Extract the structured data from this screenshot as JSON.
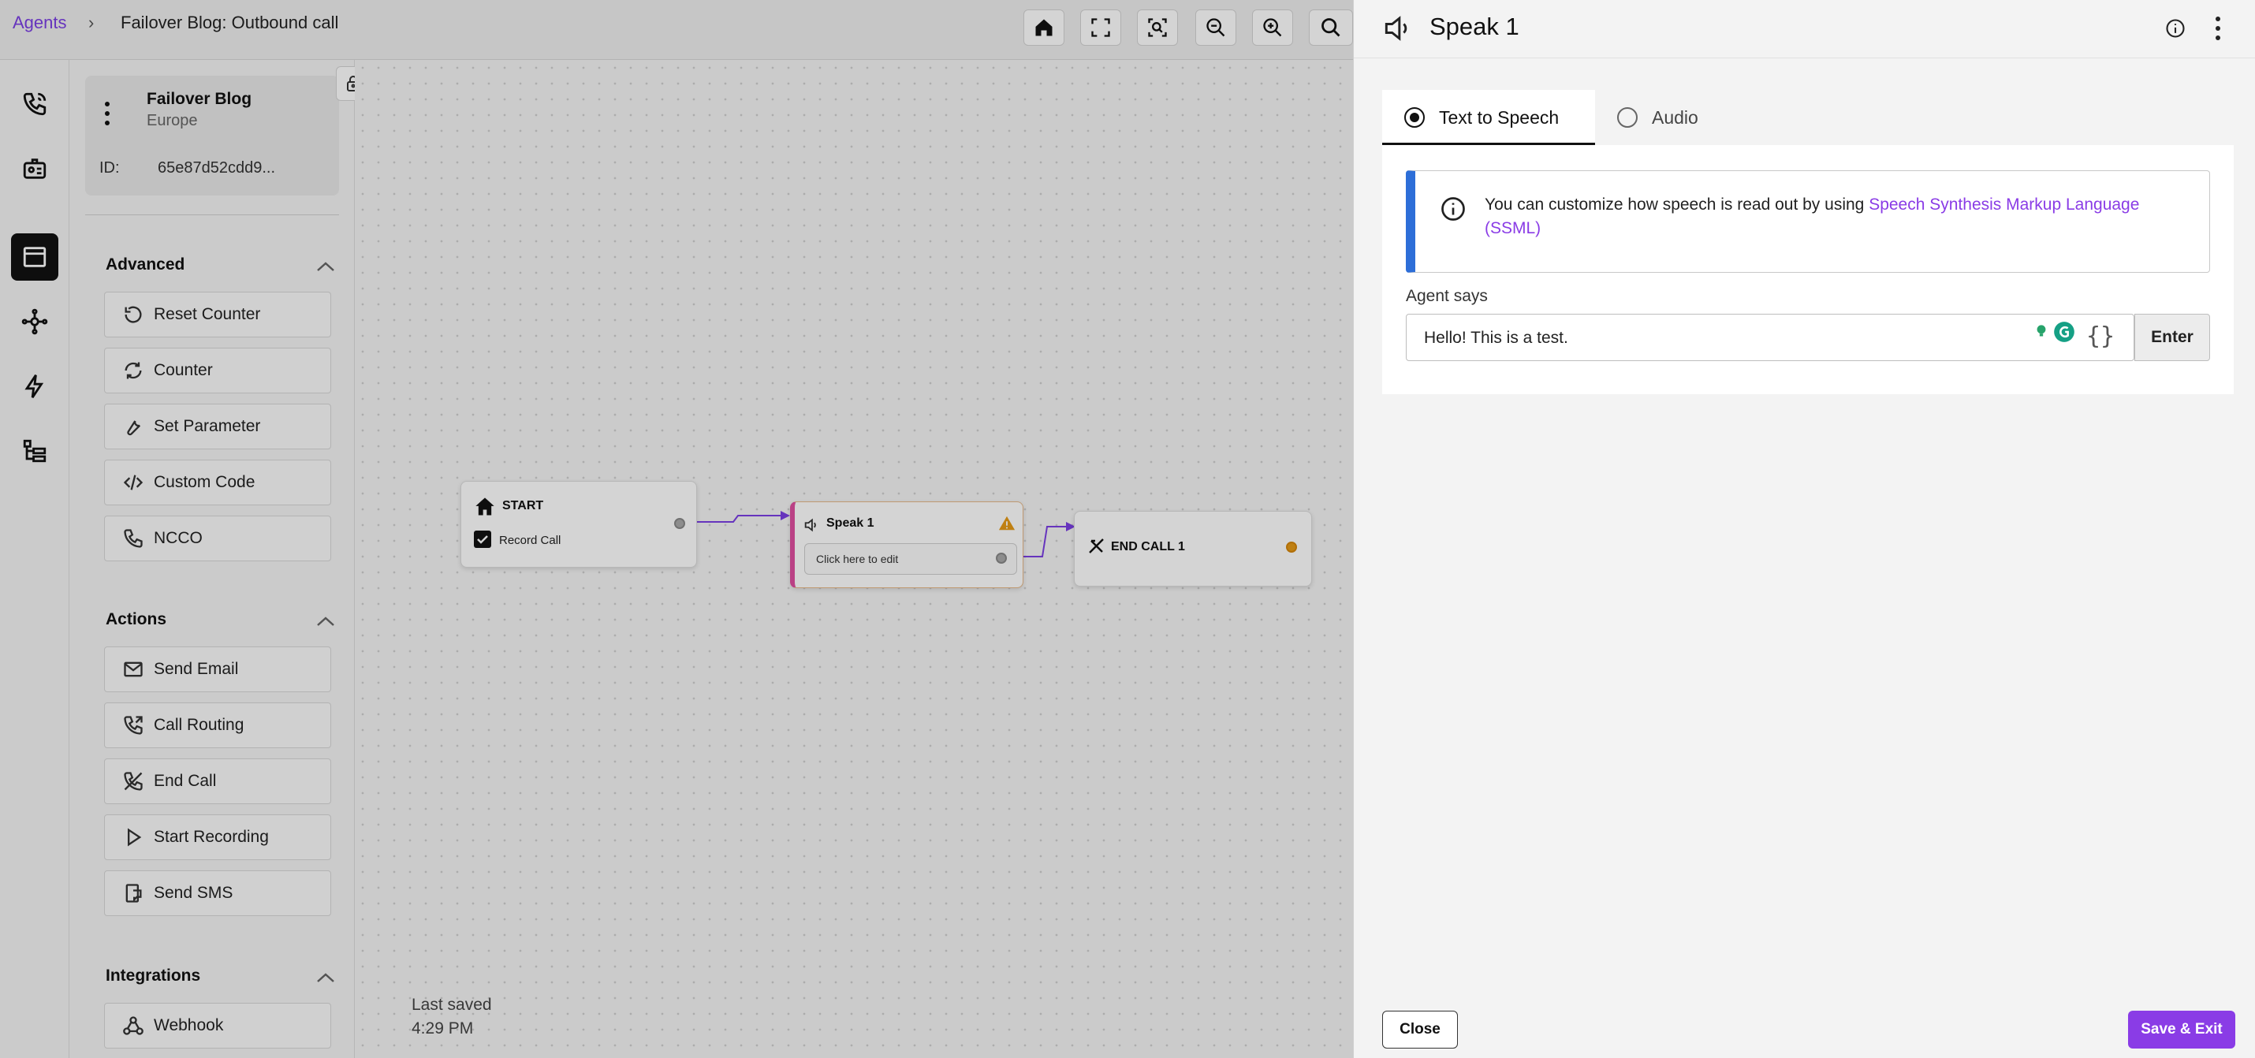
{
  "breadcrumb": {
    "root": "Agents",
    "separator": "›",
    "current": "Failover Blog: Outbound call"
  },
  "toolbar": {
    "icons": [
      "home-icon",
      "fit-view-icon",
      "focus-icon",
      "zoom-out-icon",
      "zoom-in-icon",
      "search-icon"
    ]
  },
  "rail": {
    "icons": [
      "phone-icon",
      "agent-badge-icon",
      "canvas-icon",
      "nodes-icon",
      "bolt-icon",
      "tree-icon"
    ],
    "active": "canvas-icon"
  },
  "agent": {
    "name": "Failover Blog",
    "region": "Europe",
    "id_label": "ID:",
    "id_value": "65e87d52cdd9..."
  },
  "sections": {
    "advanced": {
      "title": "Advanced",
      "items": [
        "Reset Counter",
        "Counter",
        "Set Parameter",
        "Custom Code",
        "NCCO"
      ]
    },
    "actions": {
      "title": "Actions",
      "items": [
        "Send Email",
        "Call Routing",
        "End Call",
        "Start Recording",
        "Send SMS"
      ]
    },
    "integrations": {
      "title": "Integrations",
      "items": [
        "Webhook"
      ]
    }
  },
  "canvas": {
    "start_node": {
      "title": "START",
      "checkbox_label": "Record Call",
      "checked": true
    },
    "speak_node": {
      "title": "Speak 1",
      "placeholder": "Click here to edit",
      "accent": "#e04fa0",
      "warning_color": "#e69a17"
    },
    "end_node": {
      "title": "END CALL 1",
      "port_color": "#e69a17"
    },
    "edge_color": "#7b3fe4",
    "last_saved_label": "Last saved",
    "last_saved_time": "4:29 PM"
  },
  "panel": {
    "title": "Speak 1",
    "tabs": [
      {
        "label": "Text to Speech",
        "selected": true
      },
      {
        "label": "Audio",
        "selected": false
      }
    ],
    "info_text": "You can customize how speech is read out by using ",
    "info_link": "Speech Synthesis Markup Language (SSML)",
    "field_label": "Agent says",
    "field_value": "Hello! This is a test.",
    "enter_label": "Enter",
    "close_label": "Close",
    "save_label": "Save & Exit"
  },
  "colors": {
    "accent": "#8a3ce6",
    "info_bar": "#2d6ed8"
  }
}
